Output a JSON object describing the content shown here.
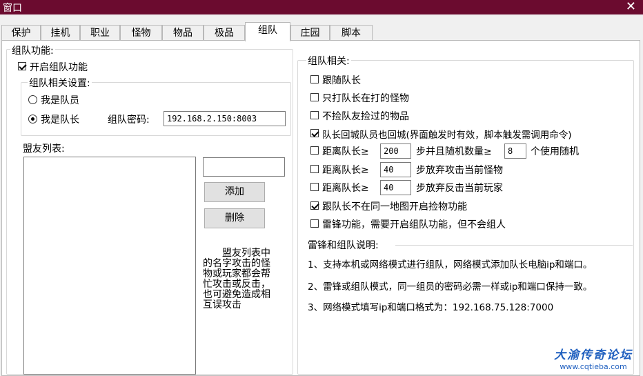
{
  "window": {
    "title": "窗口",
    "close_glyph": "✕"
  },
  "tabs": [
    {
      "label": "保护"
    },
    {
      "label": "挂机"
    },
    {
      "label": "职业"
    },
    {
      "label": "怪物"
    },
    {
      "label": "物品"
    },
    {
      "label": "极品"
    },
    {
      "label": "组队",
      "active": true
    },
    {
      "label": "庄园"
    },
    {
      "label": "脚本"
    }
  ],
  "left": {
    "group_title": "组队功能:",
    "enable_team": {
      "label": "开启组队功能",
      "checked": true
    },
    "settings_title": "组队相关设置:",
    "member_radio": {
      "label": "我是队员",
      "checked": false
    },
    "leader_radio": {
      "label": "我是队长",
      "checked": true
    },
    "password_label": "组队密码:",
    "password_value": "192.168.2.150:8003",
    "ally_title": "盟友列表:",
    "ally_input_value": "",
    "add_button": "添加",
    "delete_button": "删除",
    "ally_note": "盟友列表中的名字攻击的怪物或玩家都会帮忙攻击或反击，也可避免造成相互误攻击"
  },
  "right": {
    "group_title": "组队相关:",
    "options": {
      "follow_leader": {
        "label": "跟随队长",
        "checked": false
      },
      "only_leader_monster": {
        "label": "只打队长在打的怪物",
        "checked": false
      },
      "no_pick_leader_items": {
        "label": "不捡队友捡过的物品",
        "checked": false
      },
      "return_with_leader": {
        "label": "队长回城队员也回城(界面触发时有效，脚本触发需调用命令)",
        "checked": true
      },
      "distance_random": {
        "label_a": "距离队长≥",
        "value_a": "200",
        "label_b": "步并且随机数量≥",
        "value_b": "8",
        "label_c": "个使用随机",
        "checked": false
      },
      "distance_abandon_monster": {
        "label_a": "距离队长≥",
        "value": "40",
        "label_b": "步放弃攻击当前怪物",
        "checked": false
      },
      "distance_abandon_player": {
        "label_a": "距离队长≥",
        "value": "40",
        "label_b": "步放弃反击当前玩家",
        "checked": false
      },
      "pick_when_apart": {
        "label": "跟队长不在同一地图开启捡物功能",
        "checked": true
      },
      "thunder": {
        "label": "雷锋功能，需要开启组队功能，但不会组人",
        "checked": false
      }
    },
    "notes_title": "雷锋和组队说明:",
    "notes": [
      "1、支持本机或网络模式进行组队，网络模式添加队长电脑ip和端口。",
      "2、雷锋或组队模式，同一组员的密码必需一样或ip和端口保持一致。",
      "3、网络模式填写ip和端口格式为：192.168.75.128:7000"
    ]
  },
  "watermark": {
    "line1": "大渝传奇论坛",
    "line2": "www.cqtieba.com"
  }
}
